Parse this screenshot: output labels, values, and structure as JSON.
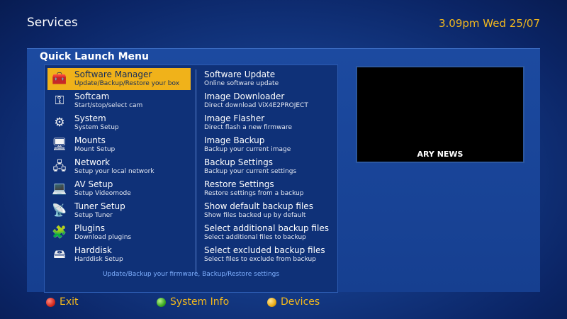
{
  "header": {
    "title": "Services",
    "clock": "3.09pm Wed 25/07"
  },
  "panel": {
    "title": "Quick Launch Menu"
  },
  "left_menu": [
    {
      "name": "Software Manager",
      "desc": "Update/Backup/Restore your box",
      "icon": "toolbox-icon",
      "selected": true
    },
    {
      "name": "Softcam",
      "desc": "Start/stop/select cam",
      "icon": "key-icon",
      "selected": false
    },
    {
      "name": "System",
      "desc": "System Setup",
      "icon": "gears-icon",
      "selected": false
    },
    {
      "name": "Mounts",
      "desc": "Mount Setup",
      "icon": "computer-icon",
      "selected": false
    },
    {
      "name": "Network",
      "desc": "Setup your local network",
      "icon": "network-icon",
      "selected": false
    },
    {
      "name": "AV Setup",
      "desc": "Setup Videomode",
      "icon": "laptop-icon",
      "selected": false
    },
    {
      "name": "Tuner Setup",
      "desc": "Setup Tuner",
      "icon": "satellite-dish-icon",
      "selected": false
    },
    {
      "name": "Plugins",
      "desc": "Download plugins",
      "icon": "puzzle-icon",
      "selected": false
    },
    {
      "name": "Harddisk",
      "desc": "Harddisk Setup",
      "icon": "harddisk-icon",
      "selected": false
    }
  ],
  "right_menu": [
    {
      "name": "Software Update",
      "desc": "Online software update"
    },
    {
      "name": "Image Downloader",
      "desc": "Direct download ViX4E2PROJECT"
    },
    {
      "name": "Image Flasher",
      "desc": "Direct flash a new firmware"
    },
    {
      "name": "Image Backup",
      "desc": "Backup your current image"
    },
    {
      "name": "Backup Settings",
      "desc": "Backup your current settings"
    },
    {
      "name": "Restore Settings",
      "desc": "Restore settings from a backup"
    },
    {
      "name": "Show default backup files",
      "desc": "Show files backed up by default"
    },
    {
      "name": "Select additional backup files",
      "desc": "Select additional files to backup"
    },
    {
      "name": "Select excluded backup files",
      "desc": "Select files to exclude from backup"
    }
  ],
  "status_text": "Update/Backup your firmware, Backup/Restore settings",
  "preview": {
    "channel": "ARY NEWS"
  },
  "footer": {
    "exit": "Exit",
    "system_info": "System Info",
    "devices": "Devices"
  },
  "colors": {
    "accent": "#f0b21a",
    "clock": "#f2b81d",
    "status": "#7fb0ff",
    "red_button": "#d52b1e",
    "green_button": "#3aa822",
    "yellow_button": "#e9aa14"
  }
}
